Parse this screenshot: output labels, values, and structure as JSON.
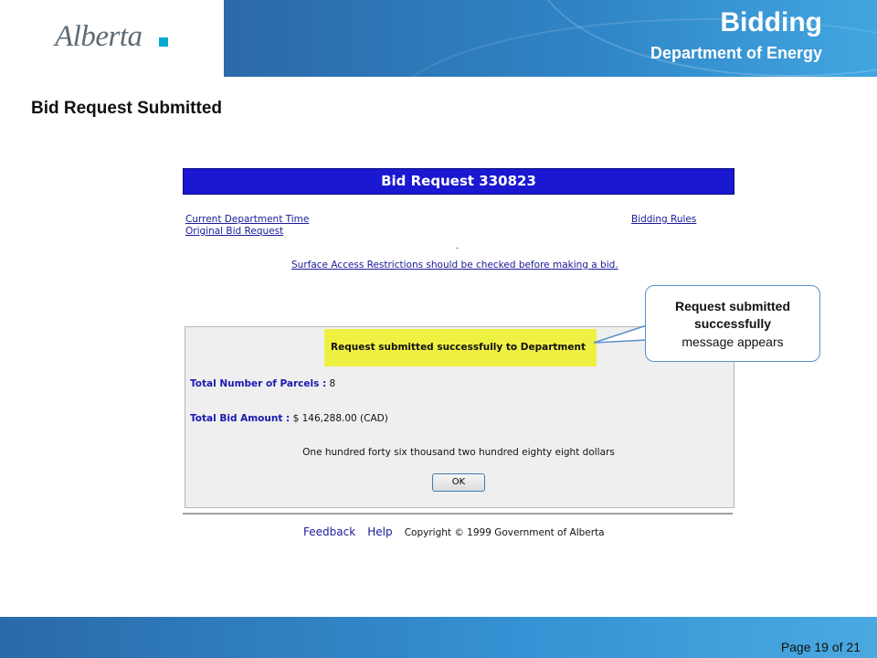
{
  "header": {
    "logo_text": "Alberta",
    "title": "Bidding",
    "subtitle": "Department of Energy"
  },
  "page_heading": "Bid Request Submitted",
  "form": {
    "title": "Bid Request  330823",
    "links": {
      "current_time": "Current Department Time",
      "original_request": "Original Bid Request",
      "bidding_rules": "Bidding Rules",
      "surface_access": "Surface Access Restrictions should be checked before making a bid."
    },
    "dot": ".",
    "success_message": "Request submitted successfully to Department",
    "total_parcels_label": "Total Number of Parcels :",
    "total_parcels_value": "8",
    "total_bid_label": "Total Bid Amount :",
    "total_bid_value": "$ 146,288.00 (CAD)",
    "amount_in_words": "One hundred forty six thousand two hundred eighty eight dollars",
    "ok_label": "OK"
  },
  "footer": {
    "feedback": "Feedback",
    "help": "Help",
    "copyright": "Copyright © 1999 Government of Alberta"
  },
  "callout": {
    "line1": "Request submitted",
    "line2": "successfully",
    "line3": "message appears"
  },
  "page_number": "Page 19 of 21",
  "colors": {
    "banner": "#2f84c6",
    "title_bar": "#1a18d0",
    "success_highlight": "#eff142",
    "link": "#1a1a9a",
    "logo_accent": "#00aad2"
  }
}
